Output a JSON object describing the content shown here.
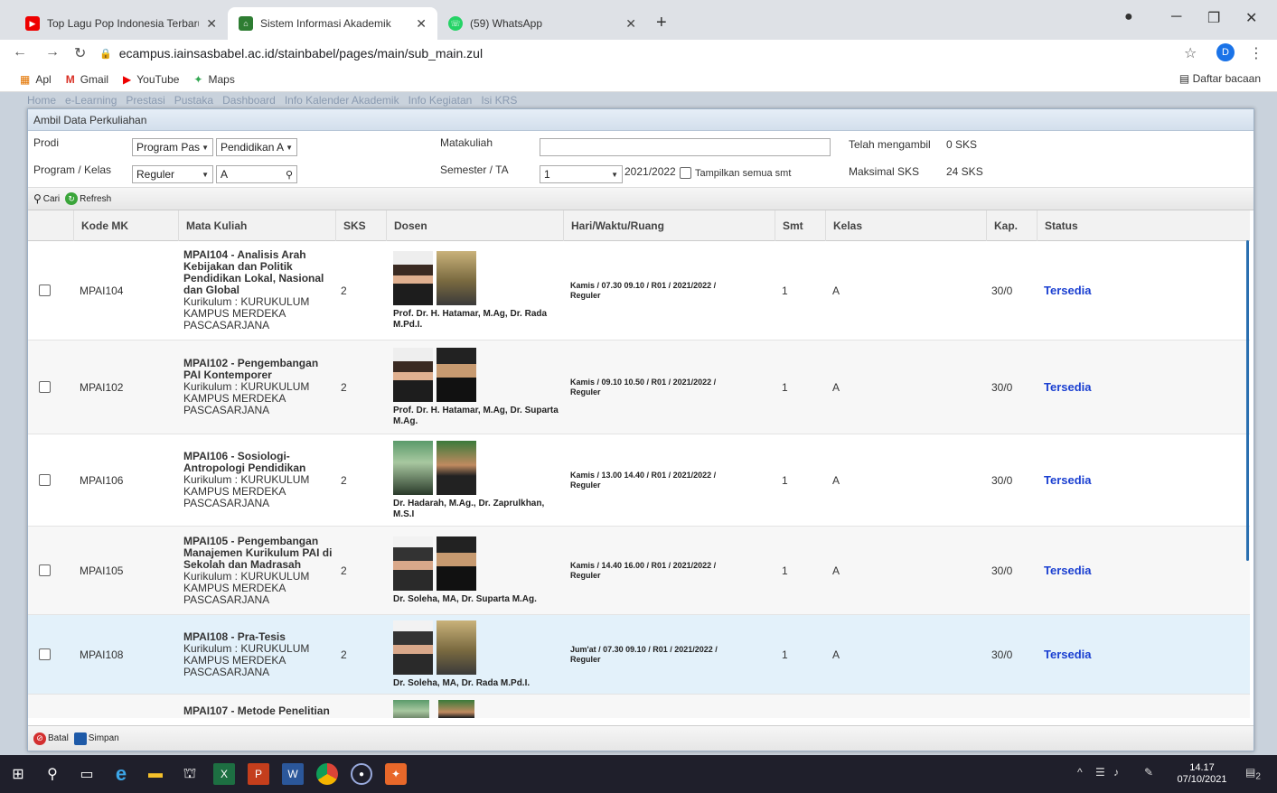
{
  "browser": {
    "tabs": [
      {
        "label": "Top Lagu Pop Indonesia Terbaru",
        "icon": "youtube-icon"
      },
      {
        "label": "Sistem Informasi Akademik",
        "icon": "campus-logo-icon"
      },
      {
        "label": "(59) WhatsApp",
        "icon": "whatsapp-icon"
      }
    ],
    "url": "ecampus.iainsasbabel.ac.id/stainbabel/pages/main/sub_main.zul",
    "profile_initial": "D",
    "bookmarks": [
      "Apl",
      "Gmail",
      "YouTube",
      "Maps"
    ],
    "reading_list": "Daftar bacaan"
  },
  "app_tabs": [
    "Home",
    "e-Learning",
    "Prestasi",
    "Pustaka",
    "Dashboard",
    "Info Kalender Akademik",
    "Info Kegiatan",
    "Isi KRS"
  ],
  "dialog": {
    "title": "Ambil Data Perkuliahan",
    "form": {
      "prodi_label": "Prodi",
      "prodi_program": "Program Pas",
      "prodi_jurusan": "Pendidikan A",
      "program_kelas_label": "Program / Kelas",
      "program_value": "Reguler",
      "kelas_value": "A",
      "matakuliah_label": "Matakuliah",
      "matakuliah_value": "",
      "semester_label": "Semester / TA",
      "semester_value": "1",
      "ta_value": "2021/2022",
      "show_all_label": "Tampilkan semua smt",
      "telah_label": "Telah mengambil",
      "telah_value": "0 SKS",
      "maks_label": "Maksimal SKS",
      "maks_value": "24 SKS"
    },
    "toolbar": {
      "cari": "Cari",
      "refresh": "Refresh"
    },
    "footer": {
      "batal": "Batal",
      "simpan": "Simpan"
    },
    "columns": [
      "Kode MK",
      "Mata Kuliah",
      "SKS",
      "Dosen",
      "Hari/Waktu/Ruang",
      "Smt",
      "Kelas",
      "Kap.",
      "Status"
    ],
    "rows": [
      {
        "kode": "MPAI104",
        "title": "MPAI104 - Analisis Arah Kebijakan dan Politik Pendidikan Lokal, Nasional dan Global",
        "kurikulum": "Kurikulum : KURUKULUM KAMPUS MERDEKA PASCASARJANA",
        "sks": "2",
        "dosen": "Prof. Dr. H. Hatamar, M.Ag, Dr. Rada M.Pd.I.",
        "jadwal": "Kamis / 07.30 09.10 / R01 / 2021/2022 / Reguler",
        "smt": "1",
        "kelas": "A",
        "kap": "30/0",
        "status": "Tersedia"
      },
      {
        "kode": "MPAI102",
        "title": "MPAI102 - Pengembangan PAI Kontemporer",
        "kurikulum": "Kurikulum : KURUKULUM KAMPUS MERDEKA PASCASARJANA",
        "sks": "2",
        "dosen": "Prof. Dr. H. Hatamar, M.Ag, Dr. Suparta M.Ag.",
        "jadwal": "Kamis / 09.10 10.50 / R01 / 2021/2022 / Reguler",
        "smt": "1",
        "kelas": "A",
        "kap": "30/0",
        "status": "Tersedia"
      },
      {
        "kode": "MPAI106",
        "title": "MPAI106 - Sosiologi-Antropologi Pendidikan",
        "kurikulum": "Kurikulum : KURUKULUM KAMPUS MERDEKA PASCASARJANA",
        "sks": "2",
        "dosen": "Dr. Hadarah, M.Ag., Dr. Zaprulkhan, M.S.I",
        "jadwal": "Kamis / 13.00 14.40 / R01 / 2021/2022 / Reguler",
        "smt": "1",
        "kelas": "A",
        "kap": "30/0",
        "status": "Tersedia"
      },
      {
        "kode": "MPAI105",
        "title": "MPAI105 - Pengembangan Manajemen Kurikulum PAI di Sekolah dan Madrasah",
        "kurikulum": "Kurikulum : KURUKULUM KAMPUS MERDEKA PASCASARJANA",
        "sks": "2",
        "dosen": "Dr. Soleha, MA, Dr. Suparta M.Ag.",
        "jadwal": "Kamis / 14.40 16.00 / R01 / 2021/2022 / Reguler",
        "smt": "1",
        "kelas": "A",
        "kap": "30/0",
        "status": "Tersedia"
      },
      {
        "kode": "MPAI108",
        "title": "MPAI108 - Pra-Tesis",
        "kurikulum": "Kurikulum : KURUKULUM KAMPUS MERDEKA PASCASARJANA",
        "sks": "2",
        "dosen": "Dr. Soleha, MA, Dr. Rada M.Pd.I.",
        "jadwal": "Jum'at / 07.30 09.10 / R01 / 2021/2022 / Reguler",
        "smt": "1",
        "kelas": "A",
        "kap": "30/0",
        "status": "Tersedia"
      },
      {
        "kode": "",
        "title": "MPAI107 - Metode Penelitian",
        "kurikulum": "",
        "sks": "",
        "dosen": "",
        "jadwal": "",
        "smt": "",
        "kelas": "",
        "kap": "",
        "status": ""
      }
    ]
  },
  "taskbar": {
    "time": "14.17",
    "date": "07/10/2021",
    "notifications": "2"
  }
}
